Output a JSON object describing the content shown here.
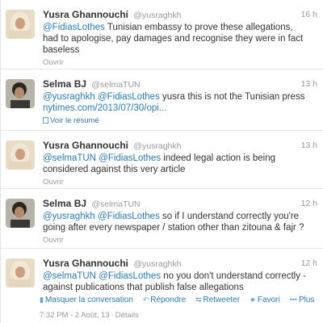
{
  "tweets": [
    {
      "fullname": "Yusra Ghannouchi",
      "username": "@yusraghkh",
      "time": "16 h",
      "mention1": "@FidiasLothes",
      "text": " Tunisian embassy to prove these allegations, had to apologise, pay damages and recognise they were in fact baseless",
      "expand": "Ouvrir"
    },
    {
      "fullname": "Selma BJ",
      "username": "@selmaTUN",
      "time": "13 h",
      "mention1": "@yusraghkh",
      "mention2": "@FidiasLothes",
      "text": " yusra this is not the Tunisian press ",
      "link": "nytimes.com/2013/07/30/opi...",
      "expand": "Voir le résumé"
    },
    {
      "fullname": "Yusra Ghannouchi",
      "username": "@yusraghkh",
      "time": "13 h",
      "mention1": "@selmaTUN",
      "mention2": "@FidiasLothes",
      "text": " indeed legal action is being considered against this very article",
      "expand": "Ouvrir"
    },
    {
      "fullname": "Selma BJ",
      "username": "@selmaTUN",
      "time": "12 h",
      "mention1": "@yusraghkh",
      "mention2": "@FidiasLothes",
      "text": " so if I understand correctly you're going after every newspaper / station other than zitouna & fajr ?",
      "expand": "Ouvrir"
    },
    {
      "fullname": "Yusra Ghannouchi",
      "username": "@yusraghkh",
      "time": "12 h",
      "mention1": "@selmaTUN",
      "mention2": "@FidiasLothes",
      "text": " no you don't understand correctly - against publications that publish false allegations",
      "actions": {
        "hide": "Masquer la conversation",
        "reply": "Répondre",
        "retweet": "Retweeter",
        "favorite": "Favori",
        "more": "Plus"
      },
      "meta": {
        "timestamp": "7:32 PM - 2 Août, 13",
        "details": "Détails"
      }
    }
  ],
  "colors": {
    "link": "#2a7ab0",
    "muted": "#999999",
    "text": "#333333"
  }
}
